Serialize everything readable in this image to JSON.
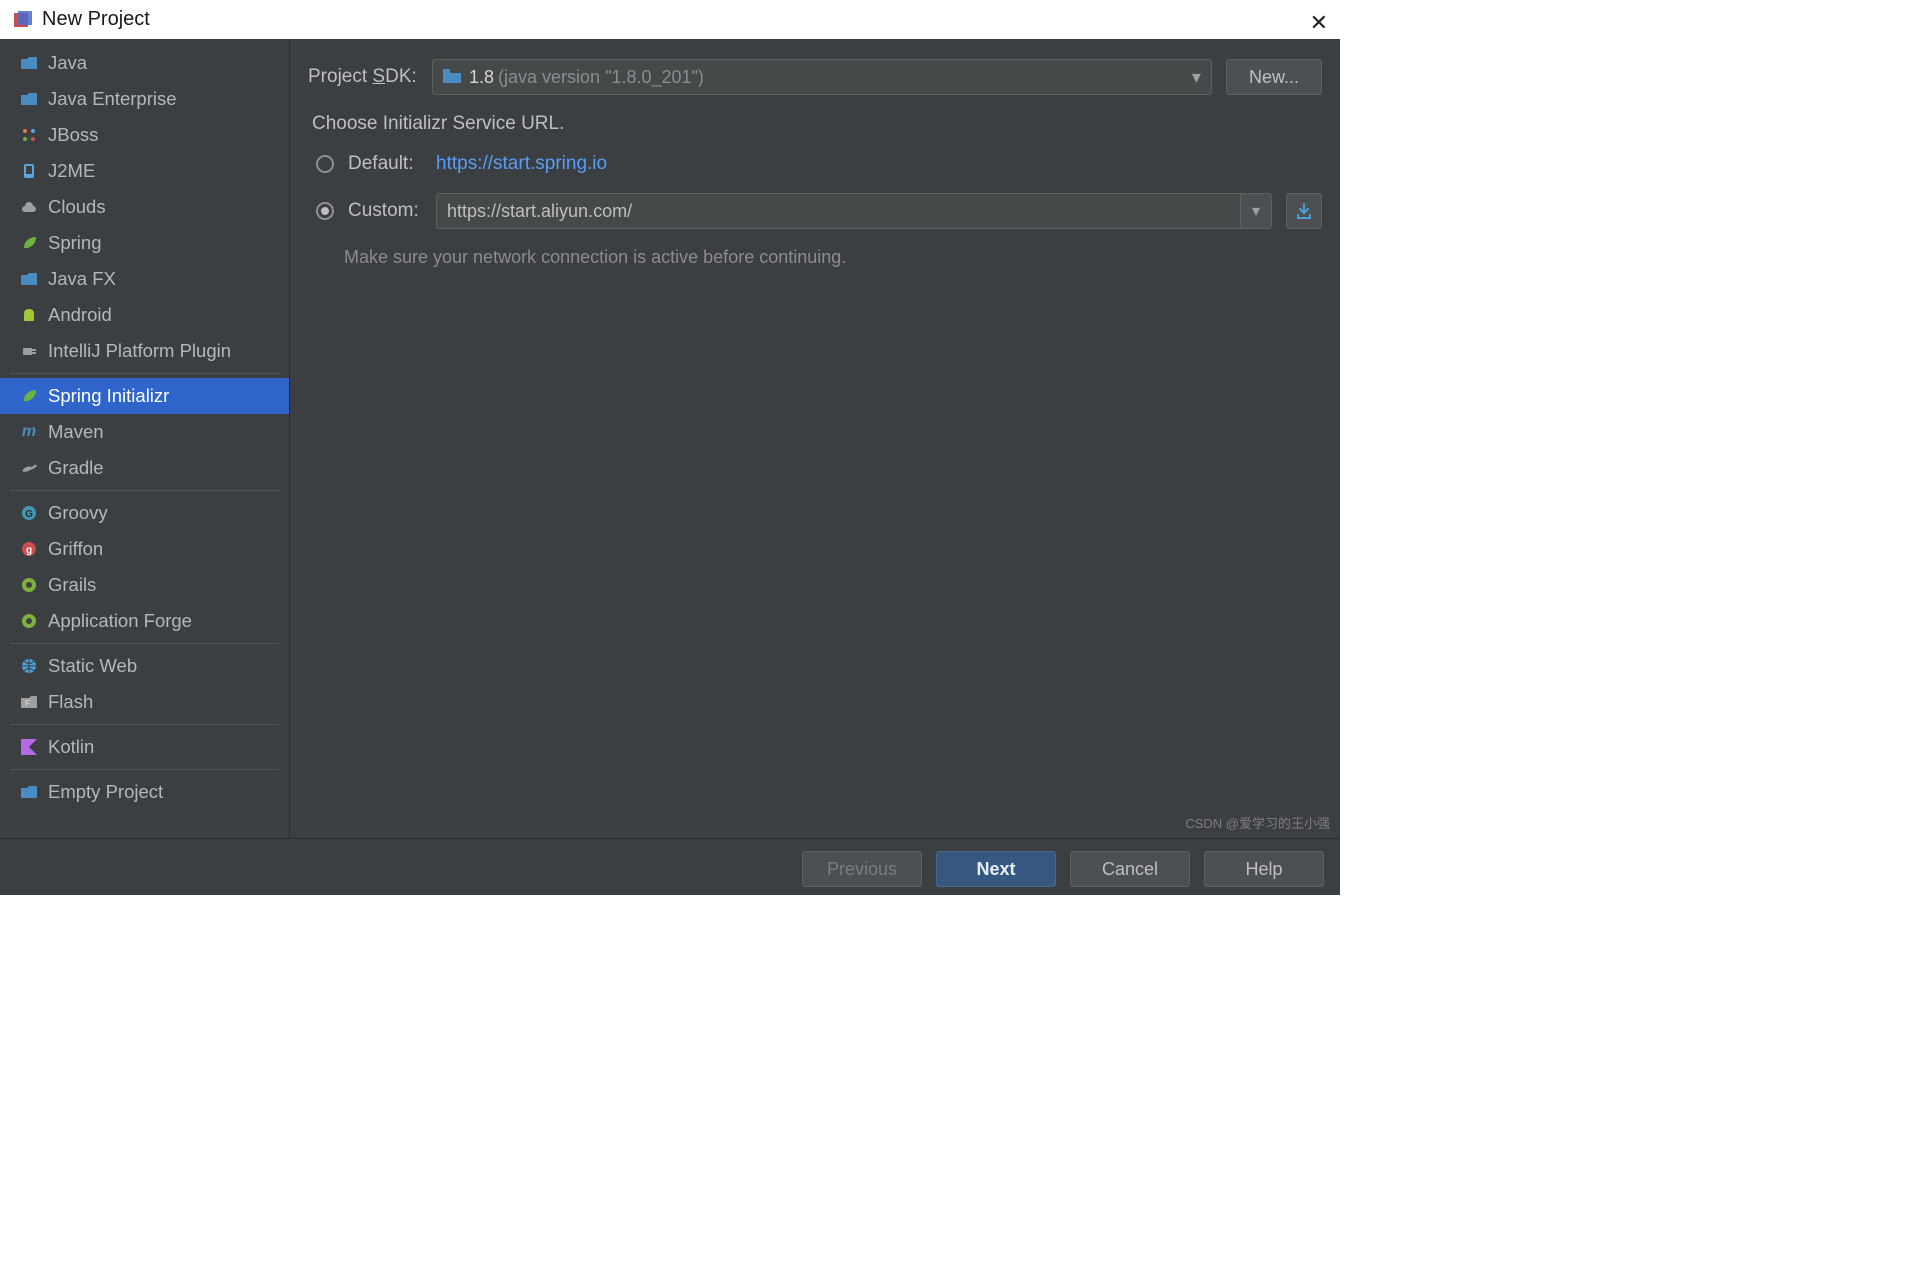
{
  "window": {
    "title": "New Project"
  },
  "sidebar": {
    "items": [
      {
        "label": "Java",
        "icon": "folder-java",
        "color": "#4a8bc2"
      },
      {
        "label": "Java Enterprise",
        "icon": "folder-enterprise",
        "color": "#4a8bc2"
      },
      {
        "label": "JBoss",
        "icon": "jboss",
        "color": "#e27b3a"
      },
      {
        "label": "J2ME",
        "icon": "j2me",
        "color": "#5aa7e0"
      },
      {
        "label": "Clouds",
        "icon": "cloud",
        "color": "#9e9e9e"
      },
      {
        "label": "Spring",
        "icon": "leaf",
        "color": "#6db33f"
      },
      {
        "label": "Java FX",
        "icon": "folder-fx",
        "color": "#4a8bc2"
      },
      {
        "label": "Android",
        "icon": "android",
        "color": "#a4c639"
      },
      {
        "label": "IntelliJ Platform Plugin",
        "icon": "plugin",
        "color": "#9e9e9e"
      },
      {
        "label": "Spring Initializr",
        "icon": "init",
        "color": "#6db33f",
        "selected": true
      },
      {
        "label": "Maven",
        "icon": "maven",
        "color": "#4a8bc2"
      },
      {
        "label": "Gradle",
        "icon": "gradle",
        "color": "#9e9e9e"
      },
      {
        "label": "Groovy",
        "icon": "groovy",
        "color": "#4298b8"
      },
      {
        "label": "Griffon",
        "icon": "griffon",
        "color": "#c94f4f"
      },
      {
        "label": "Grails",
        "icon": "grails",
        "color": "#7fb13b"
      },
      {
        "label": "Application Forge",
        "icon": "forge",
        "color": "#7fb13b"
      },
      {
        "label": "Static Web",
        "icon": "globe",
        "color": "#4aa0d8"
      },
      {
        "label": "Flash",
        "icon": "flash",
        "color": "#9e9e9e"
      },
      {
        "label": "Kotlin",
        "icon": "kotlin",
        "color": "#b36ae2"
      },
      {
        "label": "Empty Project",
        "icon": "folder-empty",
        "color": "#4a8bc2"
      }
    ],
    "dividers_after": [
      8,
      11,
      15,
      17,
      18
    ]
  },
  "main": {
    "sdk_label_pre": "Project ",
    "sdk_label_u": "S",
    "sdk_label_post": "DK:",
    "sdk_value": "1.8",
    "sdk_detail": "(java version \"1.8.0_201\")",
    "new_button": "New...",
    "choose_title": "Choose Initializr Service URL.",
    "default_label": "Default:",
    "default_url": "https://start.spring.io",
    "custom_label": "Custom:",
    "custom_value": "https://start.aliyun.com/",
    "note": "Make sure your network connection is active before continuing.",
    "radio_selected": "custom"
  },
  "footer": {
    "previous": "Previous",
    "next": "Next",
    "cancel": "Cancel",
    "help": "Help"
  },
  "watermark": "CSDN @爱学习的王小强"
}
